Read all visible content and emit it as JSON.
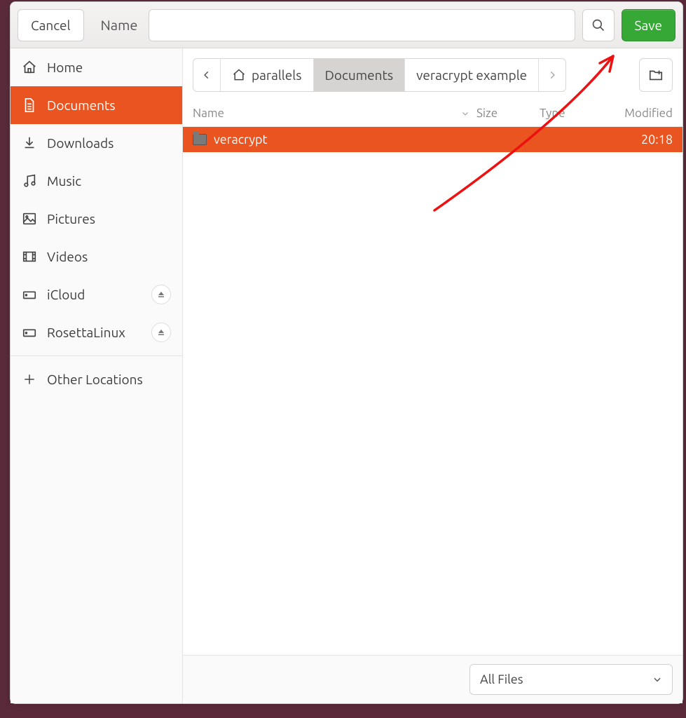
{
  "header": {
    "cancel_label": "Cancel",
    "name_label": "Name",
    "name_value": "",
    "save_label": "Save"
  },
  "sidebar": {
    "items": [
      {
        "id": "home",
        "label": "Home",
        "icon": "home-icon",
        "active": false,
        "ejectable": false
      },
      {
        "id": "documents",
        "label": "Documents",
        "icon": "document-icon",
        "active": true,
        "ejectable": false
      },
      {
        "id": "downloads",
        "label": "Downloads",
        "icon": "download-icon",
        "active": false,
        "ejectable": false
      },
      {
        "id": "music",
        "label": "Music",
        "icon": "music-icon",
        "active": false,
        "ejectable": false
      },
      {
        "id": "pictures",
        "label": "Pictures",
        "icon": "pictures-icon",
        "active": false,
        "ejectable": false
      },
      {
        "id": "videos",
        "label": "Videos",
        "icon": "videos-icon",
        "active": false,
        "ejectable": false
      },
      {
        "id": "icloud",
        "label": "iCloud",
        "icon": "drive-icon",
        "active": false,
        "ejectable": true
      },
      {
        "id": "rosettalinux",
        "label": "RosettaLinux",
        "icon": "drive-icon",
        "active": false,
        "ejectable": true
      }
    ],
    "other_locations_label": "Other Locations"
  },
  "breadcrumb": {
    "segments": [
      {
        "label": "parallels",
        "icon": "home-icon",
        "active": false
      },
      {
        "label": "Documents",
        "icon": null,
        "active": true
      },
      {
        "label": "veracrypt example",
        "icon": null,
        "active": false
      }
    ]
  },
  "table": {
    "columns": {
      "name": "Name",
      "size": "Size",
      "type": "Type",
      "modified": "Modified"
    },
    "sort": {
      "column": "name",
      "direction": "asc"
    },
    "rows": [
      {
        "name": "veracrypt",
        "kind": "folder",
        "size": "",
        "type": "",
        "modified": "20:18",
        "selected": true
      }
    ]
  },
  "footer": {
    "filter_label": "All Files"
  },
  "colors": {
    "accent": "#e95420",
    "save": "#35a835"
  }
}
